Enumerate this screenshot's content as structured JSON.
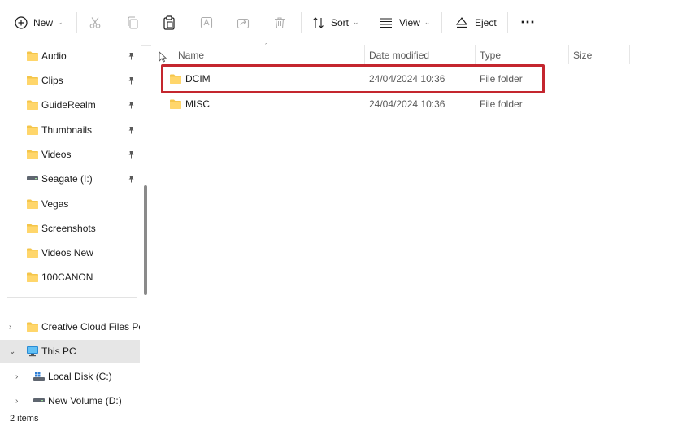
{
  "toolbar": {
    "new_label": "New",
    "sort_label": "Sort",
    "view_label": "View",
    "eject_label": "Eject",
    "more_label": "⋯"
  },
  "sidebar": {
    "quick_access": [
      {
        "label": "Audio",
        "icon": "folder-icon",
        "pinned": true
      },
      {
        "label": "Clips",
        "icon": "folder-icon",
        "pinned": true
      },
      {
        "label": "GuideRealm",
        "icon": "folder-icon",
        "pinned": true
      },
      {
        "label": "Thumbnails",
        "icon": "folder-icon",
        "pinned": true
      },
      {
        "label": "Videos",
        "icon": "folder-icon",
        "pinned": true
      },
      {
        "label": "Seagate (I:)",
        "icon": "drive-icon",
        "pinned": true
      },
      {
        "label": "Vegas",
        "icon": "folder-icon",
        "pinned": false
      },
      {
        "label": "Screenshots",
        "icon": "folder-icon",
        "pinned": false
      },
      {
        "label": "Videos New",
        "icon": "folder-icon",
        "pinned": false
      },
      {
        "label": "100CANON",
        "icon": "folder-icon",
        "pinned": false
      }
    ],
    "tree": [
      {
        "label": "Creative Cloud Files Pers",
        "icon": "folder-icon",
        "expander": "›"
      },
      {
        "label": "This PC",
        "icon": "computer-icon",
        "expander": "⌄"
      },
      {
        "label": "Local Disk (C:)",
        "icon": "windows-drive-icon",
        "expander": "›"
      },
      {
        "label": "New Volume (D:)",
        "icon": "drive-icon",
        "expander": "›"
      }
    ]
  },
  "columns": {
    "name": "Name",
    "date": "Date modified",
    "type": "Type",
    "size": "Size"
  },
  "files": [
    {
      "name": "DCIM",
      "date": "24/04/2024 10:36",
      "type": "File folder",
      "size": ""
    },
    {
      "name": "MISC",
      "date": "24/04/2024 10:36",
      "type": "File folder",
      "size": ""
    }
  ],
  "status": {
    "item_count": "2 items"
  },
  "colors": {
    "folder": "#f4c54a",
    "highlight": "#c4262e",
    "selected_bg": "#e6e6e6"
  }
}
